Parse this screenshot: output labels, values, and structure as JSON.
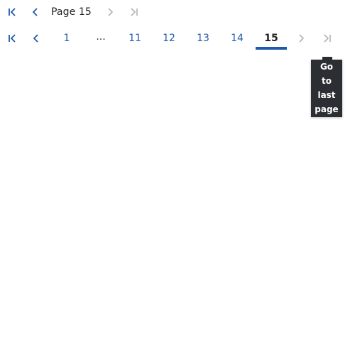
{
  "colors": {
    "accent": "#1e5aa8",
    "disabled": "#b3b3b3",
    "text": "#222222",
    "tooltip_bg": "#2b2f33"
  },
  "compact_pager": {
    "first_icon": "first-page-icon",
    "prev_icon": "chevron-left-icon",
    "page_label": "Page 15",
    "next_icon": "chevron-right-icon",
    "last_icon": "last-page-icon"
  },
  "full_pager": {
    "first_icon": "first-page-icon",
    "prev_icon": "chevron-left-icon",
    "pages": [
      "1",
      "...",
      "11",
      "12",
      "13",
      "14",
      "15"
    ],
    "current_page": "15",
    "next_icon": "chevron-right-icon",
    "last_icon": "last-page-icon"
  },
  "tooltip": {
    "lines": [
      "Go",
      "to",
      "last",
      "page"
    ]
  }
}
